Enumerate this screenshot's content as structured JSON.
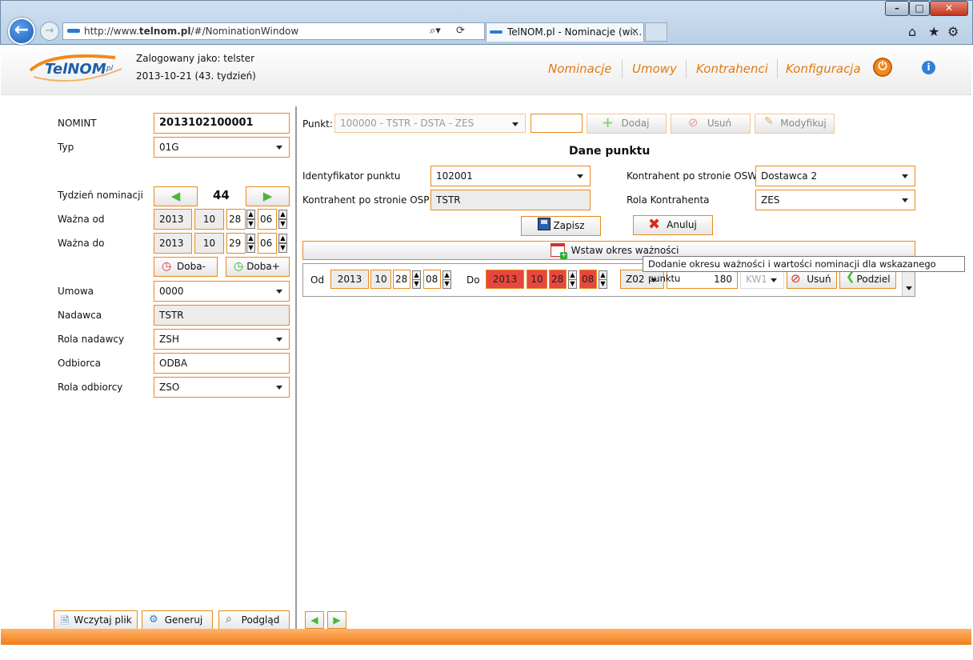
{
  "browser": {
    "url_prefix": "http://www.",
    "url_domain": "telnom.pl",
    "url_rest": "/#/NominationWindow",
    "tab_title": "TelNOM.pl - Nominacje (wi...",
    "tab_close": "✕"
  },
  "header": {
    "logo_text": "TelNOM",
    "logo_suffix": ".pl",
    "logged_as": "Zalogowany jako: telster",
    "date_line": "2013-10-21 (43. tydzień)",
    "nav": [
      "Nominacje",
      "Umowy",
      "Kontrahenci",
      "Konfiguracja"
    ]
  },
  "left": {
    "nomint_label": "NOMINT",
    "nomint_value": "2013102100001",
    "typ_label": "Typ",
    "typ_value": "01G",
    "week_label": "Tydzień nominacji",
    "week_value": "44",
    "valid_from_label": "Ważna od",
    "valid_from": {
      "year": "2013",
      "month": "10",
      "day": "28",
      "hour": "06"
    },
    "valid_to_label": "Ważna do",
    "valid_to": {
      "year": "2013",
      "month": "10",
      "day": "29",
      "hour": "06"
    },
    "day_minus": "Doba-",
    "day_plus": "Doba+",
    "umowa_label": "Umowa",
    "umowa_value": "0000",
    "nadawca_label": "Nadawca",
    "nadawca_value": "TSTR",
    "rola_nadawcy_label": "Rola nadawcy",
    "rola_nadawcy_value": "ZSH",
    "odbiorca_label": "Odbiorca",
    "odbiorca_value": "ODBA",
    "rola_odbiorcy_label": "Rola odbiorcy",
    "rola_odbiorcy_value": "ZSO",
    "btn_load": "Wczytaj plik",
    "btn_generate": "Generuj",
    "btn_preview": "Podgląd"
  },
  "right": {
    "punkt_label": "Punkt:",
    "punkt_value": "100000 - TSTR - DSTA - ZES",
    "btn_add": "Dodaj",
    "btn_remove": "Usuń",
    "btn_modify": "Modyfikuj",
    "section_title": "Dane punktu",
    "id_label": "Identyfikator punktu",
    "id_value": "102001",
    "osp_label": "Kontrahent po stronie OSP",
    "osp_value": "TSTR",
    "osw_label": "Kontrahent po stronie OSW",
    "osw_value": "Dostawca 2",
    "rola_label": "Rola Kontrahenta",
    "rola_value": "ZES",
    "btn_save": "Zapisz",
    "btn_cancel": "Anuluj",
    "btn_insert": "Wstaw okres ważności",
    "tooltip": "Dodanie okresu ważności i wartości nominacji dla wskazanego punktu",
    "row": {
      "od_label": "Od",
      "od": {
        "year": "2013",
        "month": "10",
        "day": "28",
        "hour": "08"
      },
      "do_label": "Do",
      "do": {
        "year": "2013",
        "month": "10",
        "day": "28",
        "hour": "08"
      },
      "code": "Z02",
      "amount": "180",
      "unit": "KW1",
      "btn_remove": "Usuń",
      "btn_split": "Podziel"
    }
  },
  "colors": {
    "accent": "#e8891d",
    "error": "#e8473e",
    "nav": "#e07a12"
  }
}
